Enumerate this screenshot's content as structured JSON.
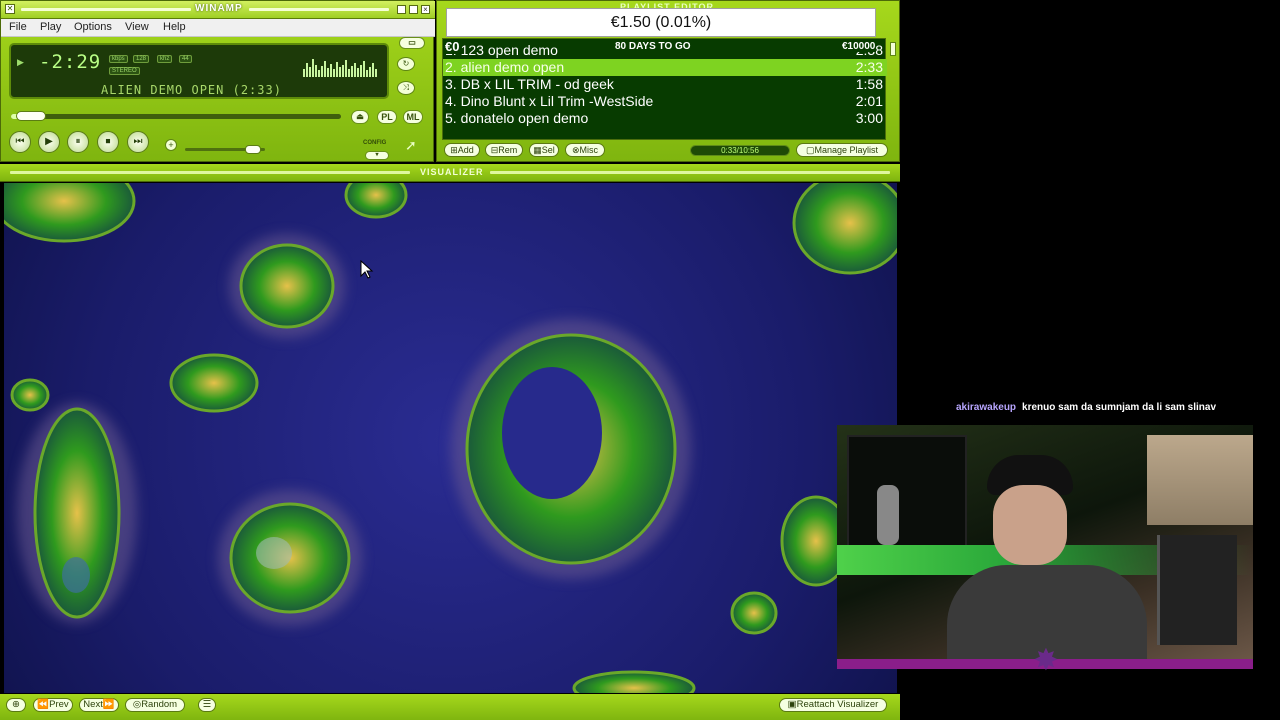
{
  "main_window": {
    "title": "WINAMP",
    "menu": {
      "file": "File",
      "play": "Play",
      "options": "Options",
      "view": "View",
      "help": "Help"
    },
    "time": "-2:29",
    "kbps": "kbps",
    "bitrate": "128",
    "khz": "khz",
    "samplerate": "44",
    "stereo": "STEREO",
    "song_title": "ALIEN DEMO OPEN (2:33)",
    "btn_pl": "PL",
    "btn_ml": "ML",
    "config_label": "CONFIG",
    "seek_progress": 0.06,
    "volume_level": 0.85
  },
  "playlist": {
    "title": "PLAYLIST EDITOR",
    "donation": "€1.50 (0.01%)",
    "goal_left": "€0",
    "goal_days": "80 DAYS TO GO",
    "goal_right": "€10000",
    "items": [
      {
        "num": "1.",
        "title": "123 open demo",
        "duration": "2:38",
        "active": false
      },
      {
        "num": "2.",
        "title": "alien demo open",
        "duration": "2:33",
        "active": true
      },
      {
        "num": "3.",
        "title": "DB x LIL TRIM - od geek",
        "duration": "1:58",
        "active": false
      },
      {
        "num": "4.",
        "title": "Dino Blunt x Lil Trim -WestSide",
        "duration": "2:01",
        "active": false
      },
      {
        "num": "5.",
        "title": "donatelo open demo",
        "duration": "3:00",
        "active": false
      }
    ],
    "buttons": {
      "add": "Add",
      "rem": "Rem",
      "sel": "Sel",
      "misc": "Misc",
      "manage": "Manage Playlist"
    },
    "total_time": "0:33/10:56"
  },
  "visualizer": {
    "title": "VISUALIZER",
    "buttons": {
      "prev": "Prev",
      "next": "Next",
      "random": "Random",
      "reattach": "Reattach Visualizer"
    }
  },
  "chat": {
    "user": "akirawakeup",
    "message": "krenuo sam da sumnjam da li sam slinav"
  },
  "colors": {
    "skin": "#9ccd1a",
    "playlist_bg": "#073b00",
    "active_row": "#7ed321",
    "vis_bg": "#1e2080",
    "vis_blob": "#2f9a1e"
  }
}
